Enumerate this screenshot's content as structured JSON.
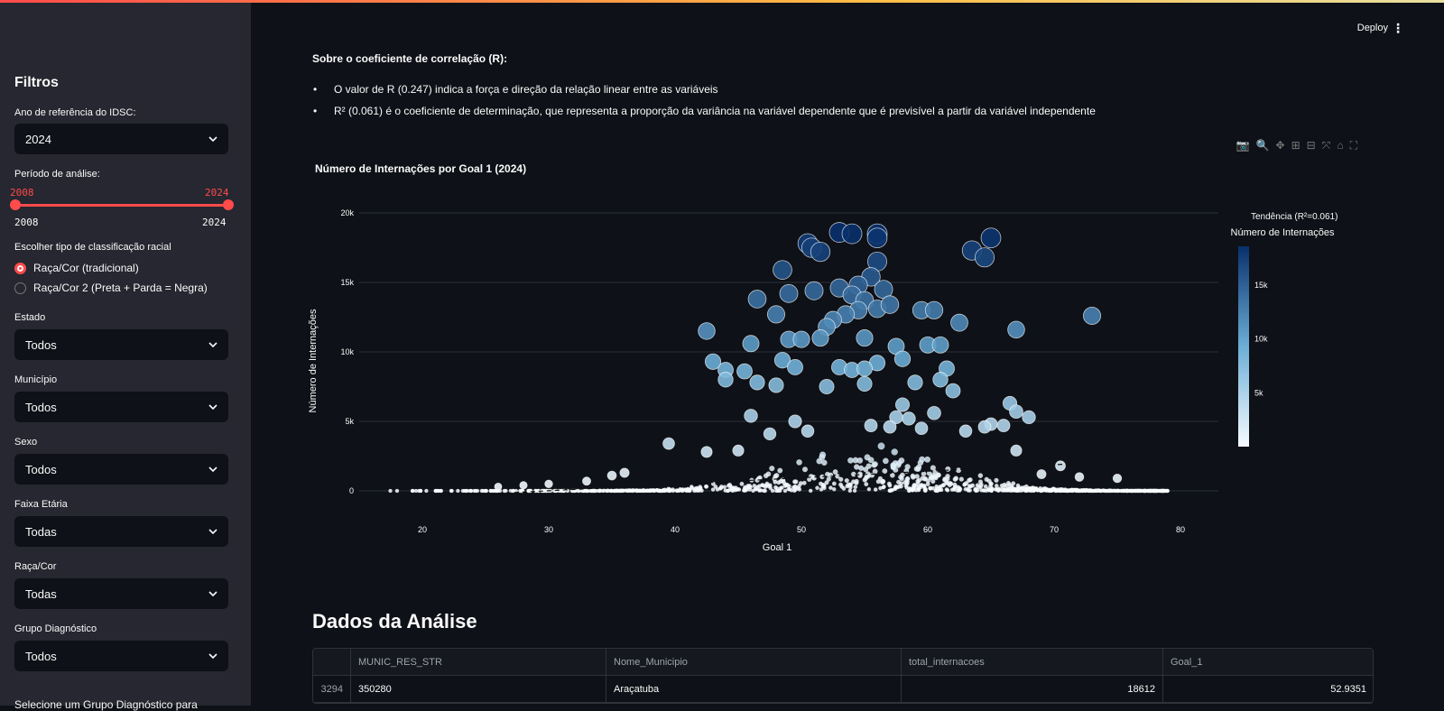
{
  "sidebar": {
    "title": "Filtros",
    "ano_label": "Ano de referência do IDSC:",
    "ano_value": "2024",
    "periodo_label": "Período de análise:",
    "periodo_start": "2008",
    "periodo_end": "2024",
    "periodo_min": "2008",
    "periodo_max": "2024",
    "race_label": "Escolher tipo de classificação racial",
    "race_opt1": "Raça/Cor (tradicional)",
    "race_opt2": "Raça/Cor 2 (Preta + Parda = Negra)",
    "estado_label": "Estado",
    "estado_value": "Todos",
    "municipio_label": "Município",
    "municipio_value": "Todos",
    "sexo_label": "Sexo",
    "sexo_value": "Todos",
    "faixa_label": "Faixa Etária",
    "faixa_value": "Todas",
    "raca_label": "Raça/Cor",
    "raca_value": "Todas",
    "grupo_label": "Grupo Diagnóstico",
    "grupo_value": "Todos",
    "cut_text": "Selecione um Grupo Diagnóstico para"
  },
  "header": {
    "deploy": "Deploy",
    "menu": "⋮"
  },
  "info": {
    "title": "Sobre o coeficiente de correlação (R):",
    "bullet1": "O valor de R (0.247) indica a força e direção da relação linear entre as variáveis",
    "bullet2": "R² (0.061) é o coeficiente de determinação, que representa a proporção da variância na variável dependente que é previsível a partir da variável independente"
  },
  "toolbar": {
    "icons": [
      "camera-icon",
      "zoom-icon",
      "pan-icon",
      "zoom-in-icon",
      "zoom-out-icon",
      "autoscale-icon",
      "reset-icon",
      "fullscreen-icon"
    ]
  },
  "chart_data": {
    "type": "scatter",
    "title": "Número de Internações por Goal 1 (2024)",
    "xlabel": "Goal 1",
    "ylabel": "Número de Internações",
    "xlim": [
      15,
      83
    ],
    "ylim": [
      0,
      20000
    ],
    "xticks": [
      "20",
      "30",
      "40",
      "50",
      "60",
      "70",
      "80"
    ],
    "yticks": [
      "0",
      "5k",
      "10k",
      "15k",
      "20k"
    ],
    "legend": "Tendência (R²=0.061)",
    "colorbar_title": "Número de Internações",
    "colorbar_ticks": [
      "5k",
      "10k",
      "15k"
    ],
    "trend": {
      "x": [
        17,
        79
      ],
      "y": [
        -600,
        2300
      ]
    },
    "points": [
      [
        53.0,
        18600
      ],
      [
        54.0,
        18500
      ],
      [
        56.0,
        18500
      ],
      [
        56.0,
        18200
      ],
      [
        65.0,
        18200
      ],
      [
        50.5,
        17800
      ],
      [
        50.8,
        17500
      ],
      [
        51.5,
        17200
      ],
      [
        63.5,
        17300
      ],
      [
        64.5,
        16800
      ],
      [
        56.0,
        16500
      ],
      [
        48.5,
        15900
      ],
      [
        55.5,
        15400
      ],
      [
        54.5,
        14800
      ],
      [
        56.5,
        14500
      ],
      [
        51.0,
        14400
      ],
      [
        53.0,
        14600
      ],
      [
        49.0,
        14200
      ],
      [
        54.0,
        14100
      ],
      [
        46.5,
        13800
      ],
      [
        55.0,
        13700
      ],
      [
        56.0,
        13100
      ],
      [
        57.0,
        13400
      ],
      [
        54.5,
        13000
      ],
      [
        53.5,
        12700
      ],
      [
        52.5,
        12300
      ],
      [
        52.0,
        11800
      ],
      [
        48.0,
        12700
      ],
      [
        59.5,
        13000
      ],
      [
        60.5,
        13000
      ],
      [
        62.5,
        12100
      ],
      [
        73.0,
        12600
      ],
      [
        42.5,
        11500
      ],
      [
        67.0,
        11600
      ],
      [
        46.0,
        10600
      ],
      [
        49.0,
        10900
      ],
      [
        50.0,
        10900
      ],
      [
        51.5,
        11000
      ],
      [
        55.0,
        11000
      ],
      [
        60.0,
        10500
      ],
      [
        61.0,
        10500
      ],
      [
        57.5,
        10400
      ],
      [
        43.0,
        9300
      ],
      [
        44.0,
        8700
      ],
      [
        45.5,
        8600
      ],
      [
        48.5,
        9400
      ],
      [
        49.5,
        8900
      ],
      [
        56.0,
        9200
      ],
      [
        58.0,
        9500
      ],
      [
        61.5,
        8800
      ],
      [
        44.0,
        8000
      ],
      [
        53.0,
        8900
      ],
      [
        54.0,
        8700
      ],
      [
        55.0,
        8800
      ],
      [
        46.5,
        7800
      ],
      [
        48.0,
        7600
      ],
      [
        52.0,
        7500
      ],
      [
        55.0,
        7700
      ],
      [
        59.0,
        7800
      ],
      [
        61.0,
        8000
      ],
      [
        62.0,
        7200
      ],
      [
        66.5,
        6300
      ],
      [
        67.0,
        5700
      ],
      [
        68.0,
        5300
      ],
      [
        65.0,
        4800
      ],
      [
        46.0,
        5400
      ],
      [
        58.0,
        6200
      ],
      [
        60.5,
        5600
      ],
      [
        57.5,
        5300
      ],
      [
        39.5,
        3400
      ],
      [
        42.5,
        2800
      ],
      [
        45.0,
        2900
      ],
      [
        47.5,
        4100
      ],
      [
        49.5,
        5000
      ],
      [
        50.5,
        4300
      ],
      [
        55.5,
        4700
      ],
      [
        57.0,
        4600
      ],
      [
        58.5,
        5200
      ],
      [
        59.5,
        4500
      ],
      [
        63.0,
        4300
      ],
      [
        64.5,
        4600
      ],
      [
        66.0,
        4700
      ],
      [
        67.0,
        2900
      ],
      [
        70.5,
        1800
      ],
      [
        69.0,
        1200
      ],
      [
        72.0,
        1000
      ],
      [
        75.0,
        900
      ],
      [
        35.0,
        1100
      ],
      [
        36.0,
        1300
      ],
      [
        33.0,
        700
      ],
      [
        30.0,
        500
      ],
      [
        28.0,
        400
      ],
      [
        26.0,
        300
      ]
    ]
  },
  "section": {
    "title": "Dados da Análise"
  },
  "table": {
    "columns": [
      "",
      "MUNIC_RES_STR",
      "Nome_Municipio",
      "total_internacoes",
      "Goal_1"
    ],
    "rows": [
      {
        "idx": "3294",
        "munic": "350280",
        "nome": "Araçatuba",
        "total": "18612",
        "goal": "52.9351"
      }
    ]
  },
  "colors": {
    "accent": "#ff4b4b",
    "background": "#0e1117",
    "sidebar": "#262730",
    "colorscale_low": "#f7fbff",
    "colorscale_high": "#08306b"
  }
}
